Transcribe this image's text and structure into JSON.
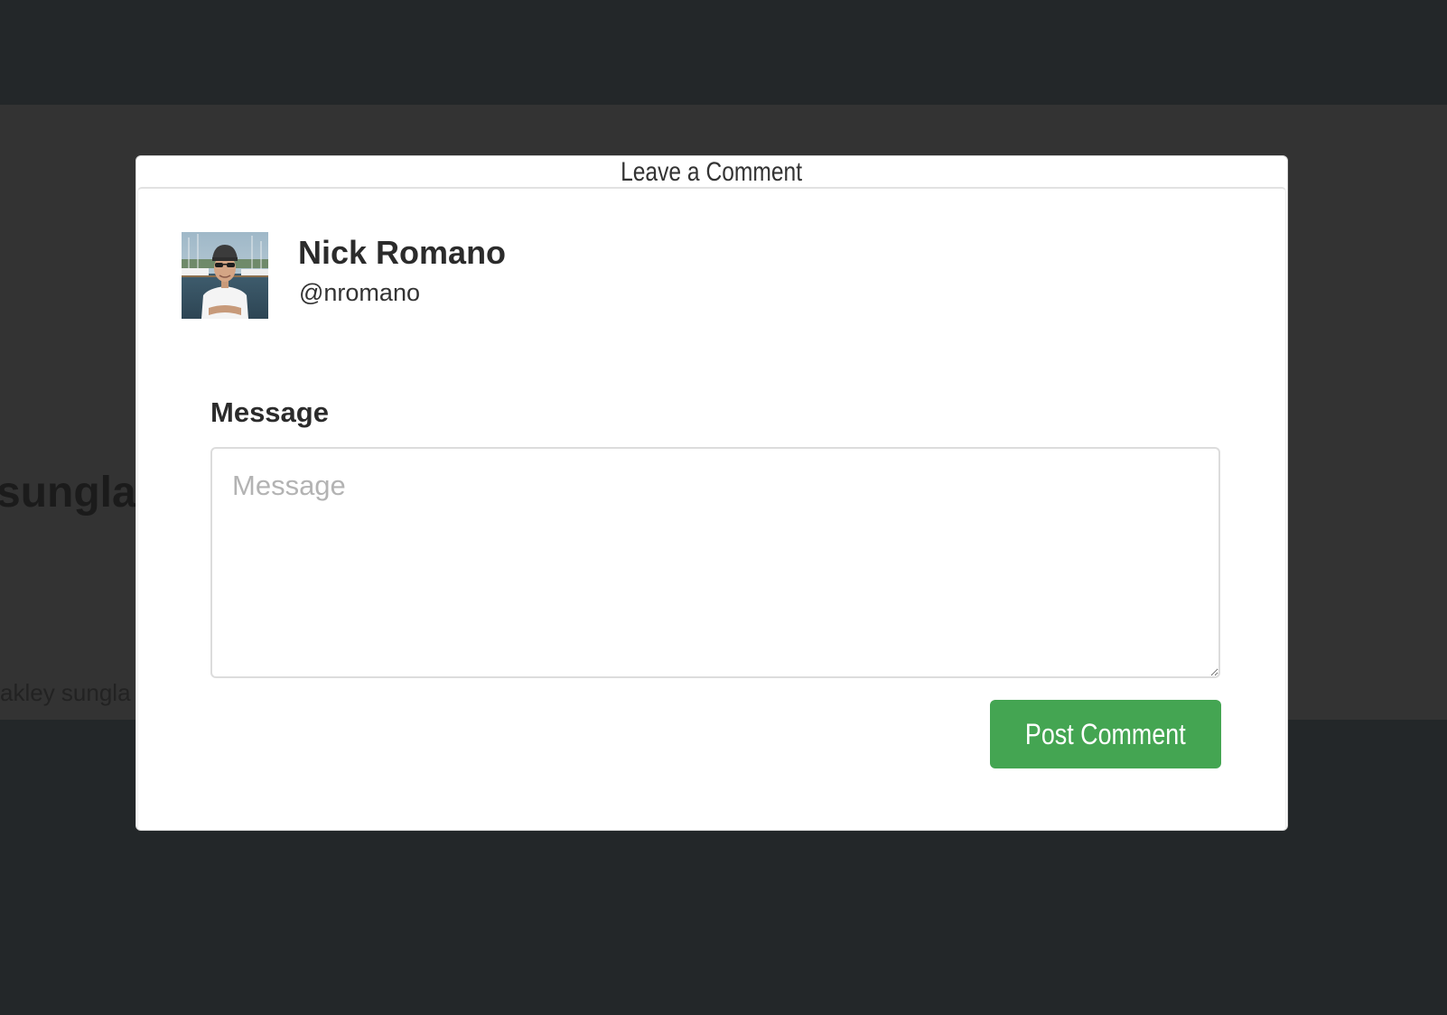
{
  "background": {
    "heading": "sunglas",
    "text": "akley sungla"
  },
  "modal": {
    "title": "Leave a Comment",
    "user": {
      "name": "Nick Romano",
      "handle": "@nromano",
      "avatar_icon": "user-avatar-photo"
    },
    "form": {
      "message_label": "Message",
      "message_placeholder": "Message",
      "message_value": "",
      "submit_label": "Post Comment"
    }
  },
  "colors": {
    "page_background": "#232729",
    "content_band": "#333333",
    "modal_background": "#ffffff",
    "button_green": "#44a552",
    "placeholder": "#b3b3b3"
  }
}
